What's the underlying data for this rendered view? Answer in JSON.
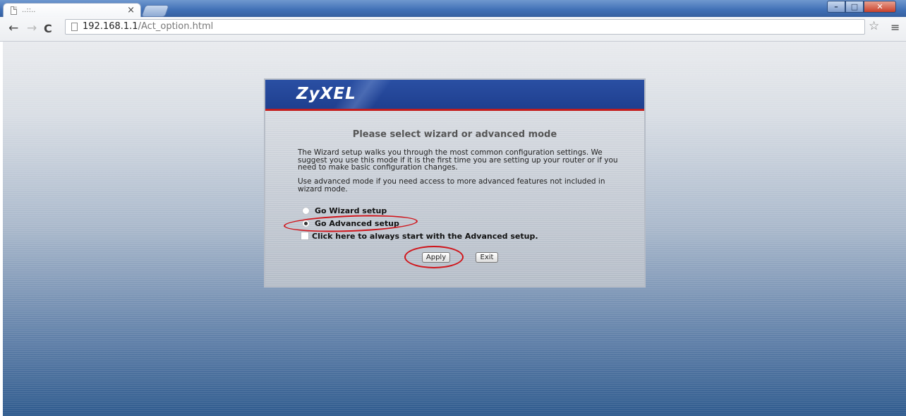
{
  "browser": {
    "tab_title": "..::..",
    "tab_close": "×",
    "url_host": "192.168.1.1",
    "url_path": "/Act_option.html",
    "back_icon": "←",
    "forward_icon": "→",
    "reload_icon": "C",
    "star_icon": "☆",
    "menu_icon": "≡",
    "min_icon": "–",
    "max_icon": "□",
    "close_icon": "✕"
  },
  "router": {
    "brand": "ZyXEL",
    "heading": "Please select wizard or advanced mode",
    "paragraph1": "The Wizard setup walks you through the most common configuration settings. We suggest you use this mode if it is the first time you are setting up your router or if you need to make basic configuration changes.",
    "paragraph2": "Use advanced mode if you need access to more advanced features not included in wizard mode.",
    "options": {
      "wizard": "Go Wizard setup",
      "advanced": "Go Advanced setup",
      "selected": "advanced"
    },
    "checkbox_label": "Click here to always start with the Advanced setup.",
    "checkbox_checked": false,
    "buttons": {
      "apply": "Apply",
      "exit": "Exit"
    }
  }
}
